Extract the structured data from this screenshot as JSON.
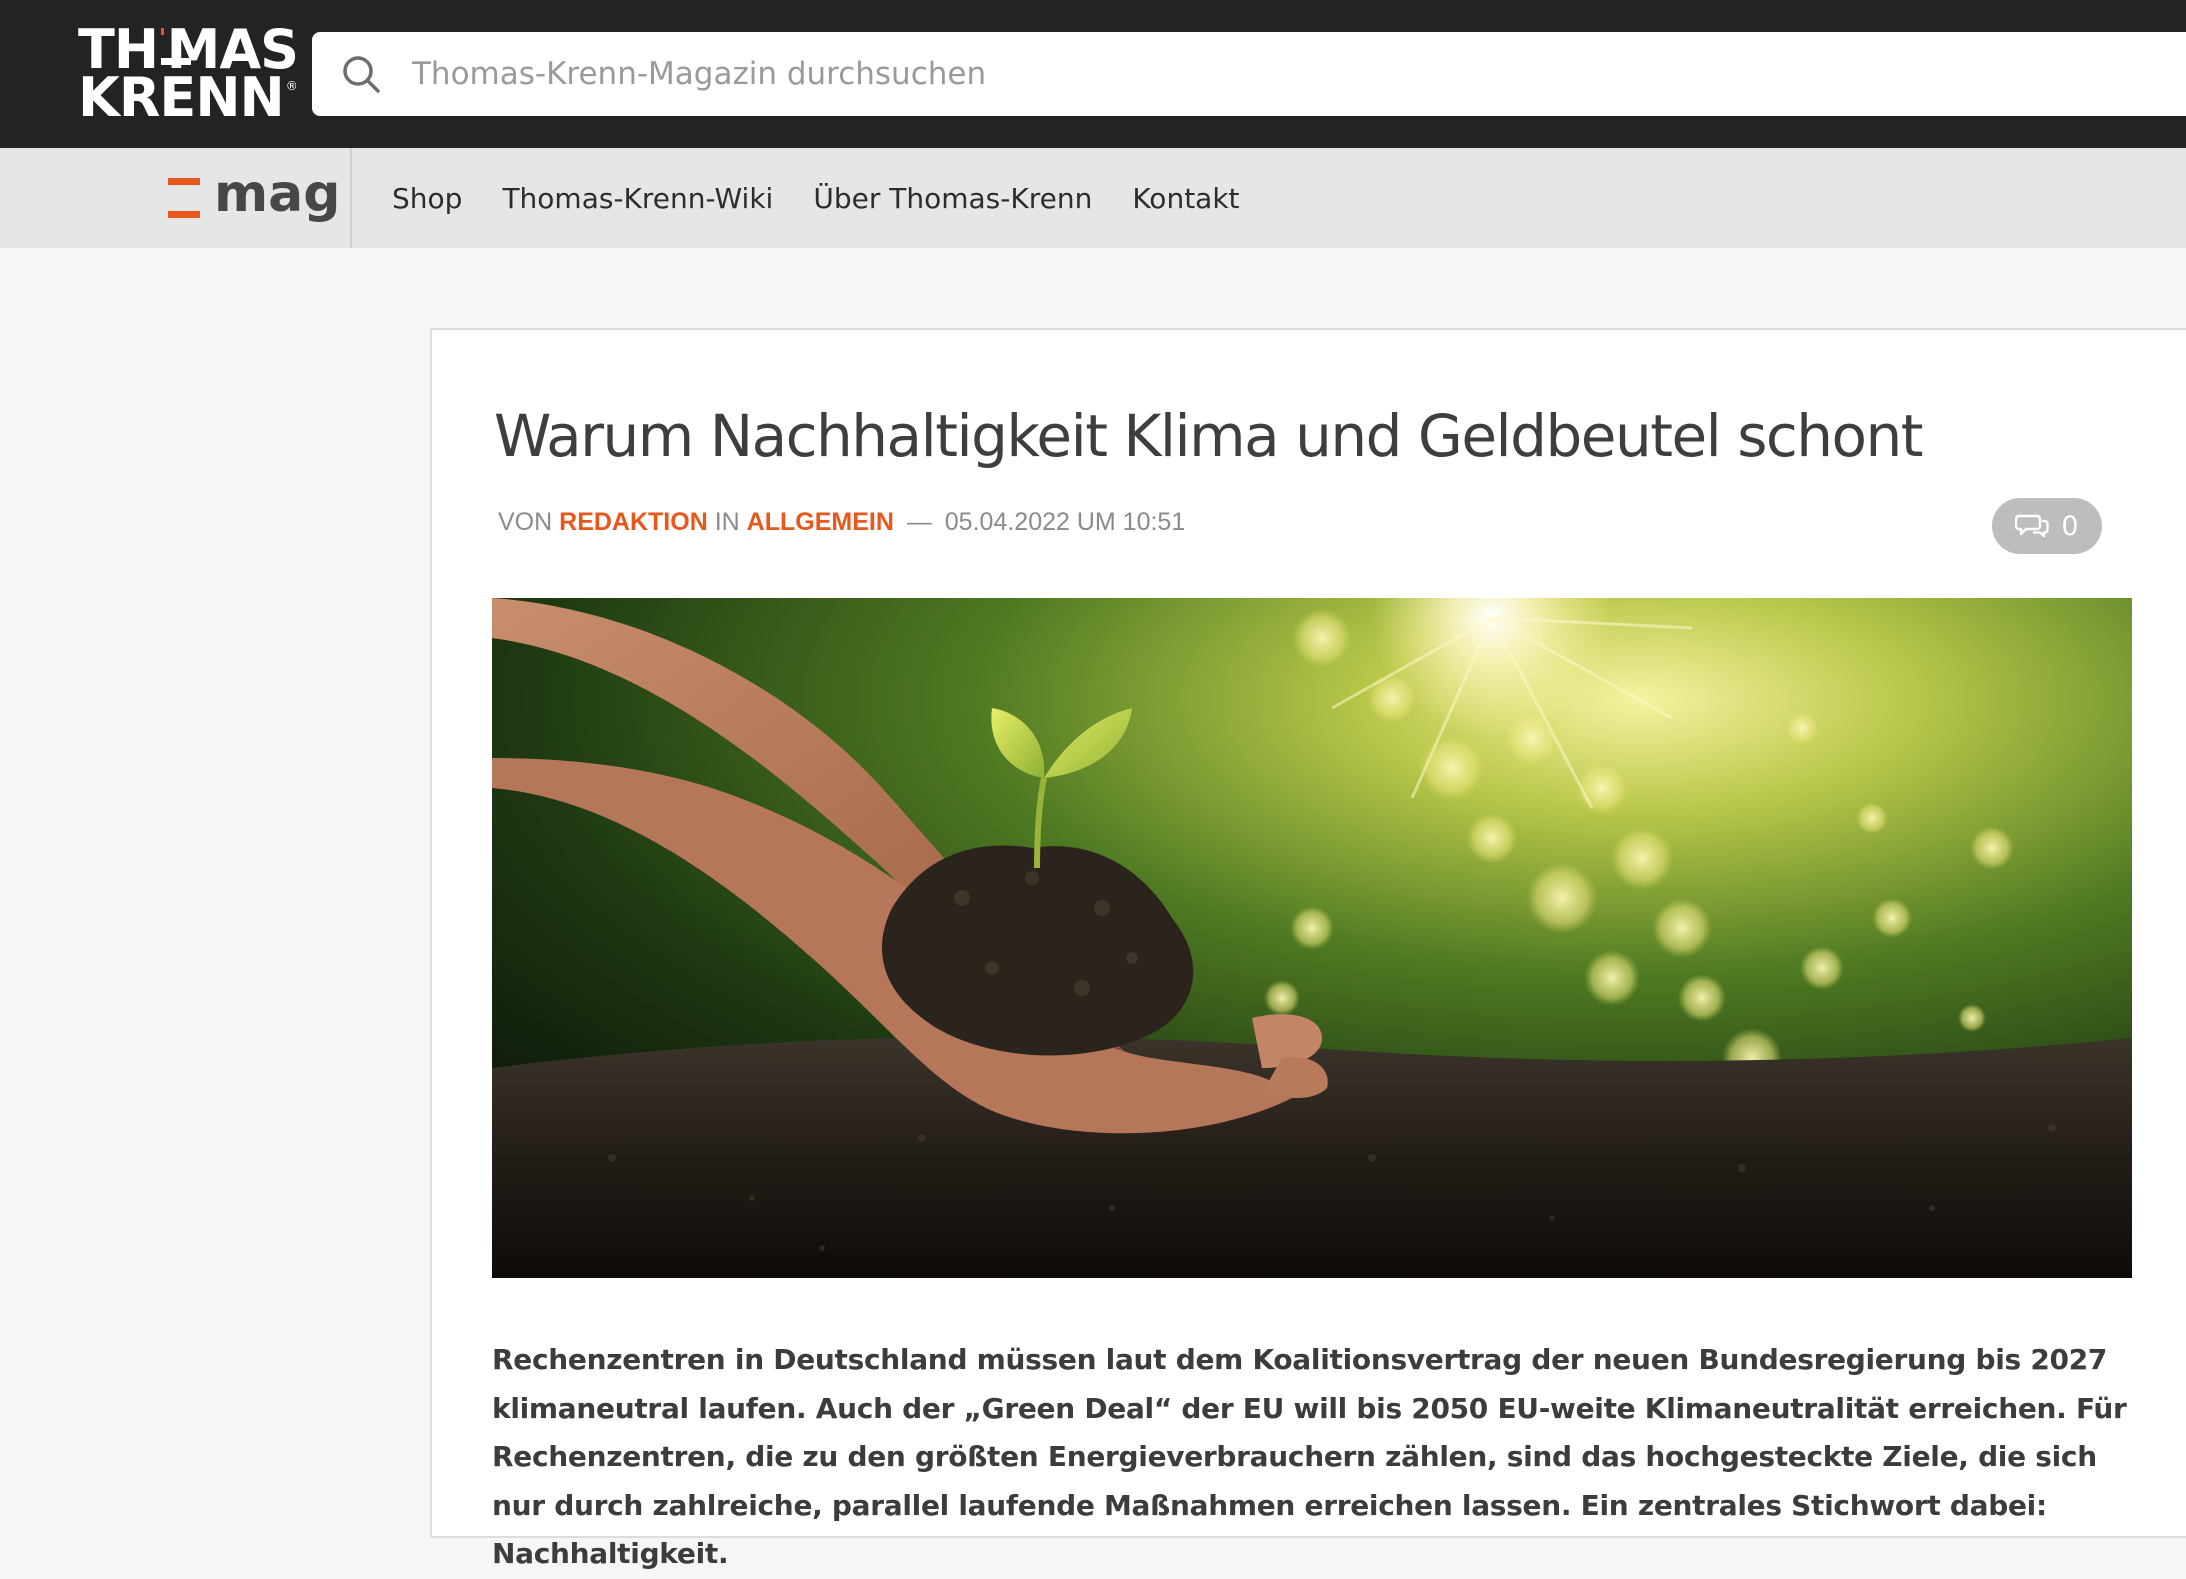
{
  "header": {
    "logo_line1_a": "TH",
    "logo_line1_b": "MAS",
    "logo_line2": "KRENN",
    "logo_reg": "®",
    "search_placeholder": "Thomas-Krenn-Magazin durchsuchen"
  },
  "nav": {
    "mag_logo": "mag",
    "items": [
      {
        "label": "Shop"
      },
      {
        "label": "Thomas-Krenn-Wiki"
      },
      {
        "label": "Über Thomas-Krenn"
      },
      {
        "label": "Kontakt"
      }
    ]
  },
  "article": {
    "title": "Warum Nachhaltigkeit Klima und Geldbeutel schont",
    "meta": {
      "by": "VON",
      "author": "REDAKTION",
      "in": "IN",
      "category": "ALLGEMEIN",
      "dash": "—",
      "date": "05.04.2022 UM 10:51"
    },
    "comment_count": "0",
    "lead": "Rechenzentren in Deutschland müssen laut dem Koalitionsvertrag der neuen Bundesregierung bis 2027 klimaneutral laufen. Auch der „Green Deal“ der EU will bis 2050 EU-weite Klimaneutralität erreichen. Für Rechenzentren, die zu den größten Energieverbrauchern zählen, sind das hochgesteckte Ziele, die sich nur durch zahlreiche, parallel laufende Maßnahmen erreichen lassen. Ein zentrales Stichwort dabei: Nachhaltigkeit."
  },
  "colors": {
    "accent": "#e8571c",
    "topbar": "#232323",
    "navbar": "#e6e6e6"
  },
  "icons": [
    "search-icon",
    "comment-icon"
  ]
}
